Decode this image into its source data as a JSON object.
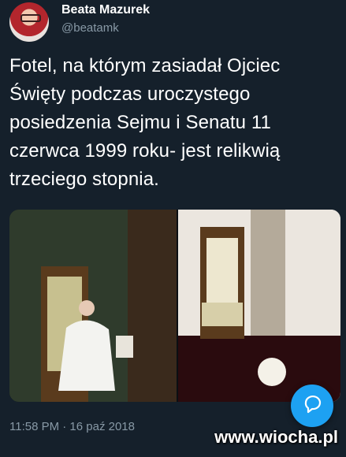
{
  "tweet": {
    "author_name": "Beata Mazurek",
    "author_handle": "@beatamk",
    "text": "Fotel, na którym zasiadał Ojciec\nŚwięty podczas uroczystego\nposiedzenia Sejmu i Senatu 11\nczerwca 1999 roku- jest relikwią\ntrzeciego stopnia.",
    "timestamp": "11:58 PM · 16 paź 2018"
  },
  "watermark": "www.wiocha.pl",
  "fab": {
    "icon": "compose-reply-icon"
  },
  "colors": {
    "background": "#15202b",
    "secondary_text": "#8899a6",
    "accent": "#1da1f2"
  }
}
